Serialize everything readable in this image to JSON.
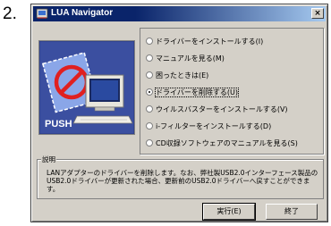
{
  "step_number": "2.",
  "window": {
    "title": "LUA Navigator",
    "close_glyph": "×"
  },
  "illustration": {
    "push_label": "PUSH"
  },
  "options": [
    {
      "label": "ドライバーをインストールする(I)",
      "selected": false
    },
    {
      "label": "マニュアルを見る(M)",
      "selected": false
    },
    {
      "label": "困ったときは(E)",
      "selected": false
    },
    {
      "label": "ドライバーを削除する(U)",
      "selected": true
    },
    {
      "label": "ウイルスバスターをインストールする(V)",
      "selected": false
    },
    {
      "label": "i-フィルターをインストールする(D)",
      "selected": false
    },
    {
      "label": "CD収録ソフトウェアのマニュアルを見る(S)",
      "selected": false
    }
  ],
  "description": {
    "legend": "説明",
    "text": "LANアダプターのドライバーを削除します。なお、弊社製USB2.0インターフェース製品のUSB2.0ドライバーが更新された場合、更新前のUSB2.0ドライバーへ戻すことができます。"
  },
  "buttons": {
    "execute": "実行(E)",
    "exit": "終了"
  },
  "colors": {
    "titlebar_start": "#0a246a",
    "titlebar_end": "#a6caf0",
    "dialog_bg": "#d4d0c8",
    "illustration_bg": "#3b4fa0"
  }
}
